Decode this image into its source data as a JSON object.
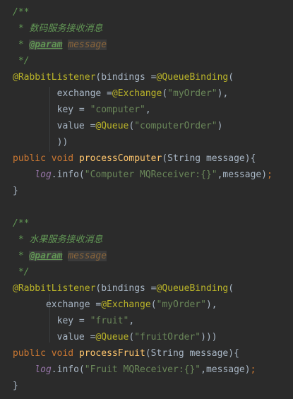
{
  "editor": {
    "lines": [
      [
        {
          "t": "/**",
          "c": "doc"
        }
      ],
      [
        {
          "t": " * 数码服务接收消息",
          "c": "doc"
        }
      ],
      [
        {
          "t": " * ",
          "c": "doc"
        },
        {
          "t": "@param",
          "c": "doc-tag"
        },
        {
          "t": " ",
          "c": "doc"
        },
        {
          "t": "message",
          "c": "doc-param"
        }
      ],
      [
        {
          "t": " */",
          "c": "doc"
        }
      ],
      [
        {
          "t": "@RabbitListener",
          "c": "ann"
        },
        {
          "t": "(bindings =",
          "c": "plain"
        },
        {
          "t": "@QueueBinding",
          "c": "ann"
        },
        {
          "t": "(",
          "c": "plain"
        }
      ],
      [
        {
          "t": "        exchange =",
          "c": "plain"
        },
        {
          "t": "@Exchange",
          "c": "ann"
        },
        {
          "t": "(",
          "c": "plain"
        },
        {
          "t": "\"myOrder\"",
          "c": "str"
        },
        {
          "t": "),",
          "c": "plain"
        }
      ],
      [
        {
          "t": "        key = ",
          "c": "plain"
        },
        {
          "t": "\"computer\"",
          "c": "str"
        },
        {
          "t": ",",
          "c": "plain"
        }
      ],
      [
        {
          "t": "        value =",
          "c": "plain"
        },
        {
          "t": "@Queue",
          "c": "ann"
        },
        {
          "t": "(",
          "c": "plain"
        },
        {
          "t": "\"computerOrder\"",
          "c": "str"
        },
        {
          "t": ")",
          "c": "plain"
        }
      ],
      [
        {
          "t": "        ))",
          "c": "plain"
        }
      ],
      [
        {
          "t": "public ",
          "c": "kw"
        },
        {
          "t": "void ",
          "c": "kw"
        },
        {
          "t": "processComputer",
          "c": "fn"
        },
        {
          "t": "(String message){",
          "c": "plain"
        }
      ],
      [
        {
          "t": "    ",
          "c": "plain"
        },
        {
          "t": "log",
          "c": "field"
        },
        {
          "t": ".info(",
          "c": "plain"
        },
        {
          "t": "\"Computer MQReceiver:{}\"",
          "c": "str"
        },
        {
          "t": ",message)",
          "c": "plain"
        },
        {
          "t": ";",
          "c": "kw"
        }
      ],
      [
        {
          "t": "}",
          "c": "plain"
        }
      ],
      [],
      [
        {
          "t": "/**",
          "c": "doc"
        }
      ],
      [
        {
          "t": " * 水果服务接收消息",
          "c": "doc"
        }
      ],
      [
        {
          "t": " * ",
          "c": "doc"
        },
        {
          "t": "@param",
          "c": "doc-tag"
        },
        {
          "t": " ",
          "c": "doc"
        },
        {
          "t": "message",
          "c": "doc-param"
        }
      ],
      [
        {
          "t": " */",
          "c": "doc"
        }
      ],
      [
        {
          "t": "@RabbitListener",
          "c": "ann"
        },
        {
          "t": "(bindings =",
          "c": "plain"
        },
        {
          "t": "@QueueBinding",
          "c": "ann"
        },
        {
          "t": "(",
          "c": "plain"
        }
      ],
      [
        {
          "t": "      exchange =",
          "c": "plain"
        },
        {
          "t": "@Exchange",
          "c": "ann"
        },
        {
          "t": "(",
          "c": "plain"
        },
        {
          "t": "\"myOrder\"",
          "c": "str"
        },
        {
          "t": "),",
          "c": "plain"
        }
      ],
      [
        {
          "t": "        key = ",
          "c": "plain"
        },
        {
          "t": "\"fruit\"",
          "c": "str"
        },
        {
          "t": ",",
          "c": "plain"
        }
      ],
      [
        {
          "t": "        value =",
          "c": "plain"
        },
        {
          "t": "@Queue",
          "c": "ann"
        },
        {
          "t": "(",
          "c": "plain"
        },
        {
          "t": "\"fruitOrder\"",
          "c": "str"
        },
        {
          "t": ")))",
          "c": "plain"
        }
      ],
      [
        {
          "t": "public ",
          "c": "kw"
        },
        {
          "t": "void ",
          "c": "kw"
        },
        {
          "t": "processFruit",
          "c": "fn"
        },
        {
          "t": "(String message){",
          "c": "plain"
        }
      ],
      [
        {
          "t": "    ",
          "c": "plain"
        },
        {
          "t": "log",
          "c": "field"
        },
        {
          "t": ".info(",
          "c": "plain"
        },
        {
          "t": "\"Fruit MQReceiver:{}\"",
          "c": "str"
        },
        {
          "t": ",message)",
          "c": "plain"
        },
        {
          "t": ";",
          "c": "kw"
        }
      ],
      [
        {
          "t": "}",
          "c": "plain"
        }
      ]
    ]
  }
}
